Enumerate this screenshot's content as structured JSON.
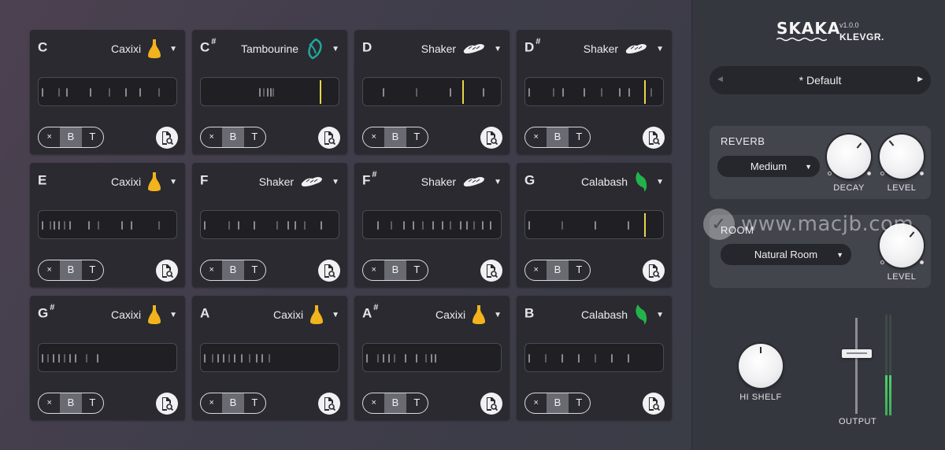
{
  "colors": {
    "accent_yellow": "#f2b31c",
    "accent_green": "#23b24b",
    "accent_teal": "#1fa89a",
    "playhead": "#e9d44b",
    "meter": "#3fae5a"
  },
  "pads": [
    {
      "note": "C",
      "sharp": "",
      "instrument": "Caxixi",
      "icon": "caxixi-icon",
      "ticks": [
        0.02,
        0.14,
        0.2,
        0.37,
        0.51,
        0.63,
        0.73,
        0.87
      ],
      "playhead": null,
      "buttons": [
        "×",
        "B",
        "T"
      ]
    },
    {
      "note": "C",
      "sharp": "#",
      "instrument": "Tambourine",
      "icon": "tambourine-icon",
      "ticks": [
        0.42,
        0.45,
        0.48,
        0.5,
        0.52
      ],
      "playhead": 0.86,
      "buttons": [
        "×",
        "B",
        "T"
      ]
    },
    {
      "note": "D",
      "sharp": "",
      "instrument": "Shaker",
      "icon": "shaker-icon",
      "ticks": [
        0.14,
        0.38,
        0.63,
        0.87
      ],
      "playhead": 0.72,
      "buttons": [
        "×",
        "B",
        "T"
      ]
    },
    {
      "note": "D",
      "sharp": "#",
      "instrument": "Shaker",
      "icon": "shaker-icon",
      "ticks": [
        0.02,
        0.2,
        0.27,
        0.42,
        0.55,
        0.68,
        0.75,
        0.91
      ],
      "playhead": 0.86,
      "buttons": [
        "×",
        "B",
        "T"
      ]
    },
    {
      "note": "E",
      "sharp": "",
      "instrument": "Caxixi",
      "icon": "caxixi-icon",
      "ticks": [
        0.02,
        0.08,
        0.11,
        0.14,
        0.18,
        0.22,
        0.36,
        0.43,
        0.6,
        0.67,
        0.87
      ],
      "playhead": null,
      "buttons": [
        "×",
        "B",
        "T"
      ]
    },
    {
      "note": "F",
      "sharp": "",
      "instrument": "Shaker",
      "icon": "shaker-icon",
      "ticks": [
        0.02,
        0.2,
        0.27,
        0.38,
        0.55,
        0.63,
        0.68,
        0.75,
        0.87
      ],
      "playhead": null,
      "buttons": [
        "×",
        "B",
        "T"
      ]
    },
    {
      "note": "F",
      "sharp": "#",
      "instrument": "Shaker",
      "icon": "shaker-icon",
      "ticks": [
        0.1,
        0.2,
        0.29,
        0.36,
        0.43,
        0.5,
        0.57,
        0.63,
        0.7,
        0.75,
        0.8,
        0.86,
        0.92
      ],
      "playhead": null,
      "buttons": [
        "×",
        "B",
        "T"
      ]
    },
    {
      "note": "G",
      "sharp": "",
      "instrument": "Calabash",
      "icon": "calabash-icon",
      "ticks": [
        0.02,
        0.26,
        0.5,
        0.74
      ],
      "playhead": 0.86,
      "buttons": [
        "×",
        "B",
        "T"
      ]
    },
    {
      "note": "G",
      "sharp": "#",
      "instrument": "Caxixi",
      "icon": "caxixi-icon",
      "ticks": [
        0.02,
        0.06,
        0.1,
        0.14,
        0.18,
        0.22,
        0.26,
        0.34,
        0.42
      ],
      "playhead": null,
      "buttons": [
        "×",
        "B",
        "T"
      ]
    },
    {
      "note": "A",
      "sharp": "",
      "instrument": "Caxixi",
      "icon": "caxixi-icon",
      "ticks": [
        0.02,
        0.08,
        0.12,
        0.16,
        0.2,
        0.24,
        0.29,
        0.35,
        0.4,
        0.44,
        0.49
      ],
      "playhead": null,
      "buttons": [
        "×",
        "B",
        "T"
      ]
    },
    {
      "note": "A",
      "sharp": "#",
      "instrument": "Caxixi",
      "icon": "caxixi-icon",
      "ticks": [
        0.02,
        0.1,
        0.14,
        0.18,
        0.22,
        0.3,
        0.38,
        0.45,
        0.49,
        0.52
      ],
      "playhead": null,
      "buttons": [
        "×",
        "B",
        "T"
      ]
    },
    {
      "note": "B",
      "sharp": "",
      "instrument": "Calabash",
      "icon": "calabash-icon",
      "ticks": [
        0.02,
        0.14,
        0.26,
        0.38,
        0.5,
        0.62,
        0.74
      ],
      "playhead": null,
      "buttons": [
        "×",
        "B",
        "T"
      ]
    }
  ],
  "panel": {
    "logo": "SKAKA",
    "version": "v1.0.0",
    "brand": "KLEVGR.",
    "preset": {
      "name": "* Default",
      "prev": "◀",
      "next": "▶"
    },
    "reverb": {
      "label": "REVERB",
      "type": "Medium",
      "decay_label": "DECAY",
      "level_label": "LEVEL"
    },
    "room": {
      "label": "ROOM",
      "type": "Natural Room",
      "level_label": "LEVEL"
    },
    "hi_shelf_label": "HI SHELF",
    "output_label": "OUTPUT",
    "output_meter_left": 0.4,
    "output_meter_right": 0.4
  },
  "watermark": "www.macjb.com"
}
